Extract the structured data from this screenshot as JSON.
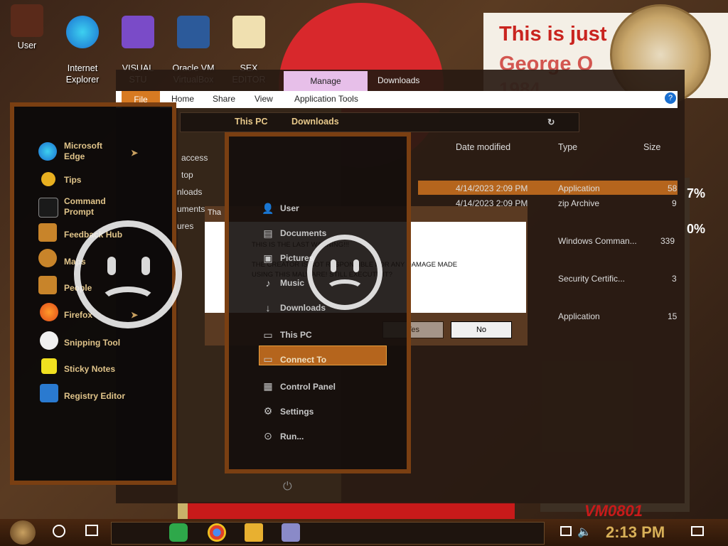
{
  "desktop": {
    "icons": [
      {
        "name": "user-icon",
        "label": "User"
      },
      {
        "name": "internet-explorer-icon",
        "label": "Internet\nExplorer"
      },
      {
        "name": "visual-studio-icon",
        "label": "VISUAL\nSTU"
      },
      {
        "name": "oracle-vm-virtualbox-icon",
        "label": "Oracle VM\nVirtualBox"
      },
      {
        "name": "sex-editor-icon",
        "label": "SEX\nEDITOR"
      }
    ],
    "poster_line1": "This is just",
    "poster_line2": "George O",
    "poster_line3": "1984",
    "percent1": "7%",
    "percent2": "0%",
    "vm_text": "VM0801"
  },
  "explorer": {
    "title": "Downloads",
    "manage_tab": "Manage",
    "tabs": {
      "file": "File",
      "home": "Home",
      "share": "Share",
      "view": "View",
      "app_tools": "Application Tools"
    },
    "address": {
      "this_pc": "This PC",
      "downloads": "Downloads"
    },
    "columns": {
      "date": "Date modified",
      "type": "Type",
      "size": "Size"
    },
    "rows": [
      {
        "date": "4/14/2023 2:09 PM",
        "type": "Application",
        "size": "58"
      },
      {
        "date": "4/14/2023 2:09 PM",
        "type": "zip Archive",
        "size": "9"
      },
      {
        "date": "",
        "type": "Windows Comman...",
        "size": "339"
      },
      {
        "date": "",
        "type": "Security Certific...",
        "size": "3"
      },
      {
        "date": "",
        "type": "Application",
        "size": "15"
      }
    ],
    "sidebar": {
      "access": "access",
      "top": "top",
      "downloads": "nloads",
      "documents": "uments",
      "pictures": "ures"
    }
  },
  "dialog": {
    "title": "Tha",
    "line1": "THIS IS THE LAST WARNING!!!",
    "line2": "THE CREATOR IS NOT RESPONSIBLE FOR ANY DAMAGE MADE",
    "line3": "USING THIS MALWARE! STILL EXECUTE IT?",
    "yes": "Yes",
    "no": "No"
  },
  "start_left": {
    "items": [
      {
        "name": "microsoft-edge",
        "label": "Microsoft\nEdge"
      },
      {
        "name": "tips",
        "label": "Tips"
      },
      {
        "name": "command-prompt",
        "label": "Command\nPrompt"
      },
      {
        "name": "feedback-hub",
        "label": "Feedback Hub"
      },
      {
        "name": "maps",
        "label": "Maps"
      },
      {
        "name": "people",
        "label": "People"
      },
      {
        "name": "firefox",
        "label": "Firefox"
      },
      {
        "name": "snipping-tool",
        "label": "Snipping Tool"
      },
      {
        "name": "sticky-notes",
        "label": "Sticky Notes"
      },
      {
        "name": "registry-editor",
        "label": "Registry Editor"
      }
    ]
  },
  "start_right": {
    "items": [
      {
        "name": "user",
        "label": "User"
      },
      {
        "name": "documents",
        "label": "Documents"
      },
      {
        "name": "pictures",
        "label": "Pictures"
      },
      {
        "name": "music",
        "label": "Music"
      },
      {
        "name": "downloads",
        "label": "Downloads"
      },
      {
        "name": "this-pc",
        "label": "This PC"
      },
      {
        "name": "connect-to",
        "label": "Connect To"
      },
      {
        "name": "control-panel",
        "label": "Control Panel"
      },
      {
        "name": "settings",
        "label": "Settings"
      },
      {
        "name": "run",
        "label": "Run..."
      }
    ]
  },
  "taskbar": {
    "time": "2:13 PM"
  },
  "colors": {
    "accent": "#b5651d",
    "menu_text": "#e0c48a",
    "clock_text": "#d8b058",
    "stop_red": "#d8282c"
  }
}
